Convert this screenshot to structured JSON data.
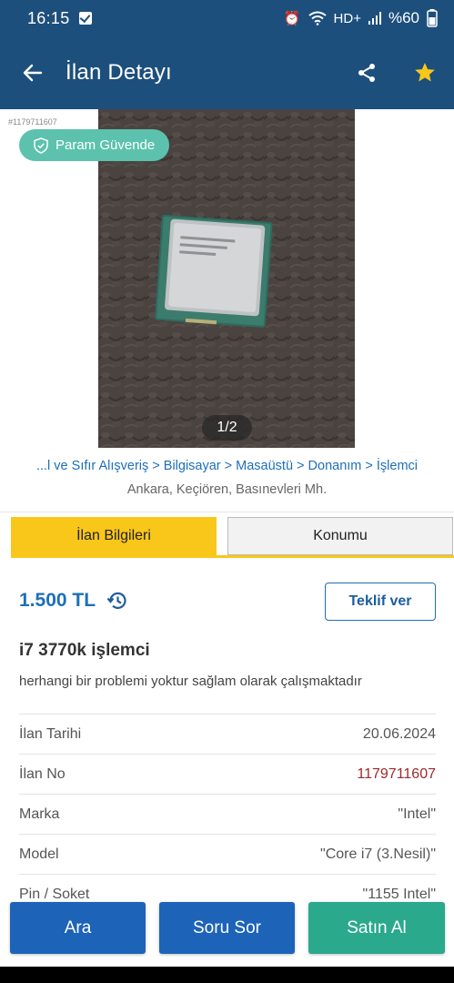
{
  "status_bar": {
    "time": "16:15",
    "network": "HD+",
    "battery": "%60"
  },
  "app_bar": {
    "title": "İlan Detayı"
  },
  "gallery": {
    "listing_id_small": "#1179711607",
    "safe_badge": "Param Güvende",
    "pager": "1/2"
  },
  "breadcrumb": {
    "path": "...l ve Sıfır Alışveriş > Bilgisayar > Masaüstü > Donanım > İşlemci",
    "location": "Ankara, Keçiören, Basınevleri Mh."
  },
  "tabs": [
    {
      "label": "İlan Bilgileri",
      "active": true
    },
    {
      "label": "Konumu",
      "active": false
    }
  ],
  "listing": {
    "price": "1.500 TL",
    "offer_button": "Teklif ver",
    "title": "i7 3770k işlemci",
    "description": "herhangi bir problemi yoktur sağlam olarak çalışmaktadır",
    "details": [
      {
        "label": "İlan Tarihi",
        "value": "20.06.2024"
      },
      {
        "label": "İlan No",
        "value": "1179711607"
      },
      {
        "label": "Marka",
        "value": "\"Intel\""
      },
      {
        "label": "Model",
        "value": "\"Core i7 (3.Nesil)\""
      },
      {
        "label": "Pin / Soket",
        "value": "\"1155 Intel\""
      }
    ]
  },
  "bottom_actions": {
    "search": "Ara",
    "ask": "Soru Sor",
    "buy": "Satın Al"
  },
  "colors": {
    "primary": "#1d4f7c",
    "link": "#1d6fb8",
    "accent": "#f9c61a",
    "buy": "#2aa98d",
    "listing_no": "#a0282a"
  }
}
